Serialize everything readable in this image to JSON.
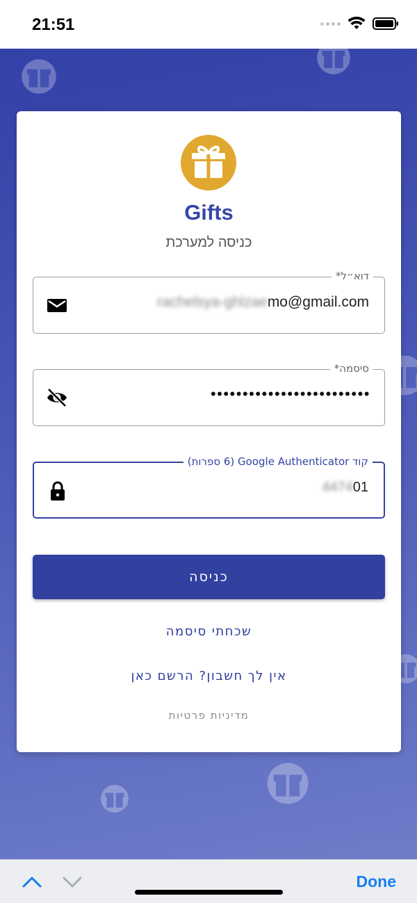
{
  "status": {
    "time": "21:51"
  },
  "app": {
    "title": "Gifts",
    "subtitle": "כניסה למערכת"
  },
  "fields": {
    "email": {
      "label": "דוא״ל*",
      "value": "mo@gmail.com",
      "value_obscured": "rachelsya-ghlzae"
    },
    "password": {
      "label": "סיסמה*",
      "value": "•••••••••••••••••••••••••"
    },
    "code": {
      "label": "קוד Google Authenticator (6 ספרות)",
      "value": "01",
      "value_obscured": "4474"
    }
  },
  "buttons": {
    "login": "כניסה",
    "done": "Done"
  },
  "links": {
    "forgot_password": "שכחתי סיסמה",
    "register": "אין לך חשבון? הרשם כאן",
    "privacy": "מדיניות פרטיות"
  },
  "colors": {
    "primary": "#3241a0",
    "accent_gold": "#e0a82e",
    "done_blue": "#1a7cf2"
  },
  "icons": {
    "email": "mail-icon",
    "password": "eye-off-icon",
    "code": "lock-icon",
    "logo": "gift-icon"
  }
}
